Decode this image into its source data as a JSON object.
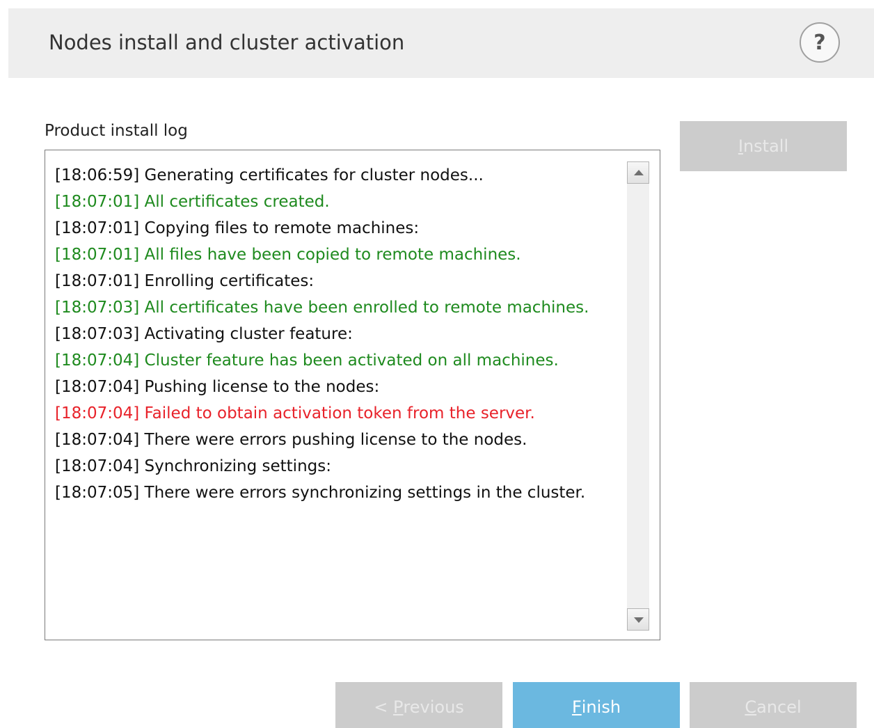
{
  "header": {
    "title": "Nodes install and cluster activation",
    "help_label": "?"
  },
  "log": {
    "label": "Product install log",
    "lines": [
      {
        "text": "[18:06:59] Generating certificates for cluster nodes...",
        "status": "info"
      },
      {
        "text": "[18:07:01] All certificates created.",
        "status": "success"
      },
      {
        "text": "[18:07:01] Copying files to remote machines:",
        "status": "info"
      },
      {
        "text": "[18:07:01] All files have been copied to remote machines.",
        "status": "success"
      },
      {
        "text": "[18:07:01] Enrolling certificates:",
        "status": "info"
      },
      {
        "text": "[18:07:03] All certificates have been enrolled to remote machines.",
        "status": "success"
      },
      {
        "text": "[18:07:03] Activating cluster feature:",
        "status": "info"
      },
      {
        "text": "[18:07:04] Cluster feature has been activated on all machines.",
        "status": "success"
      },
      {
        "text": "[18:07:04] Pushing license to the nodes:",
        "status": "info"
      },
      {
        "text": "[18:07:04] Failed to obtain activation token from the server.",
        "status": "error"
      },
      {
        "text": "[18:07:04] There were errors pushing license to the nodes.",
        "status": "info"
      },
      {
        "text": "[18:07:04] Synchronizing settings:",
        "status": "info"
      },
      {
        "text": "[18:07:05] There were errors synchronizing settings in the cluster.",
        "status": "info"
      }
    ]
  },
  "buttons": {
    "install": {
      "mnemonic": "I",
      "rest": "nstall",
      "enabled": false
    },
    "previous": {
      "prefix": "< ",
      "mnemonic": "P",
      "rest": "revious",
      "enabled": false
    },
    "finish": {
      "mnemonic": "F",
      "rest": "inish",
      "enabled": true
    },
    "cancel": {
      "mnemonic": "C",
      "rest": "ancel",
      "enabled": false
    }
  },
  "colors": {
    "info": "#111111",
    "success": "#1e8a1e",
    "error": "#e8222a",
    "primary_button": "#6bb8e0",
    "disabled_button": "#cccccc",
    "header_bg": "#eeeeee"
  },
  "icons": {
    "help": "help-circle-icon",
    "scroll_up": "scroll-up-arrow-icon",
    "scroll_down": "scroll-down-arrow-icon"
  }
}
